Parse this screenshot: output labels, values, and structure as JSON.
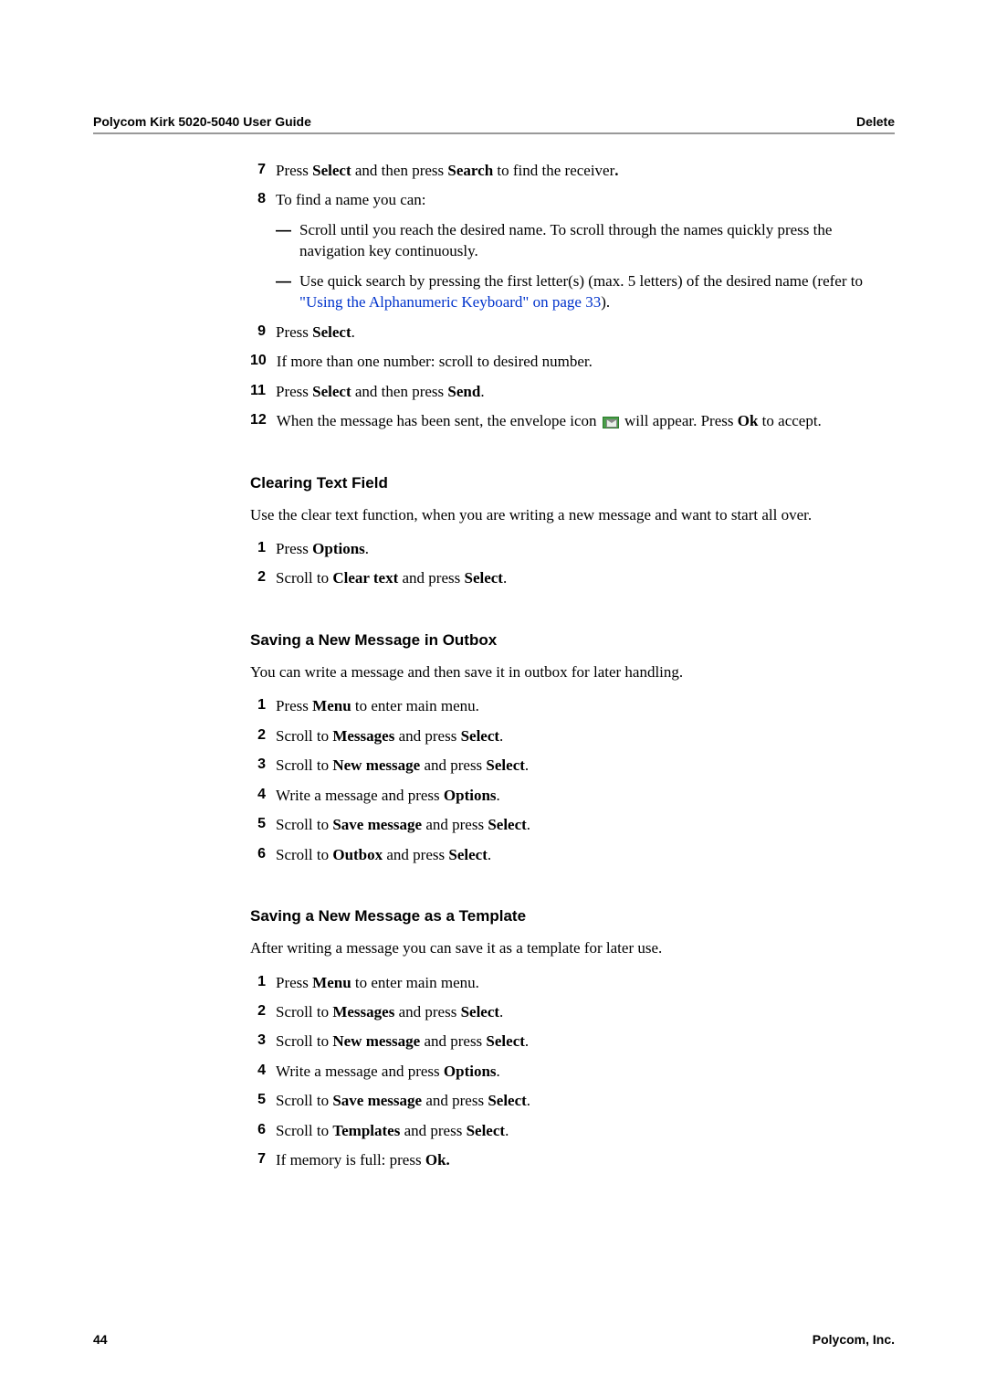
{
  "header": {
    "left": "Polycom Kirk 5020-5040 User Guide",
    "right": "Delete"
  },
  "continued_steps": [
    {
      "num": "7",
      "segments": [
        {
          "t": "Press "
        },
        {
          "t": "Select",
          "b": true
        },
        {
          "t": " and then press "
        },
        {
          "t": "Search",
          "b": true
        },
        {
          "t": " to find the receiver"
        },
        {
          "t": ".",
          "b": true
        }
      ]
    },
    {
      "num": "8",
      "segments": [
        {
          "t": "To find a name you can:"
        }
      ],
      "sub": [
        {
          "segments": [
            {
              "t": "Scroll until you reach the desired name. To scroll through the names quickly press the navigation key continuously."
            }
          ]
        },
        {
          "segments": [
            {
              "t": "Use quick search by pressing the first letter(s) (max. 5 letters) of the desired name (refer to "
            },
            {
              "t": "\"Using the Alphanumeric Keyboard\" on page 33",
              "link": true
            },
            {
              "t": ")."
            }
          ]
        }
      ]
    },
    {
      "num": "9",
      "segments": [
        {
          "t": "Press "
        },
        {
          "t": "Select",
          "b": true
        },
        {
          "t": "."
        }
      ]
    },
    {
      "num": "10",
      "segments": [
        {
          "t": "If more than one number: scroll to desired number."
        }
      ]
    },
    {
      "num": "11",
      "segments": [
        {
          "t": "Press "
        },
        {
          "t": "Select",
          "b": true
        },
        {
          "t": " and then press "
        },
        {
          "t": "Send",
          "b": true
        },
        {
          "t": "."
        }
      ]
    },
    {
      "num": "12",
      "segments": [
        {
          "t": "When the message has been sent, the envelope icon "
        },
        {
          "t": "",
          "icon": "envelope"
        },
        {
          "t": " will appear. Press "
        },
        {
          "t": "Ok",
          "b": true
        },
        {
          "t": " to accept."
        }
      ]
    }
  ],
  "sections": [
    {
      "heading": "Clearing Text Field",
      "intro": "Use the clear text function, when you are writing a new message and want to start all over.",
      "steps": [
        {
          "num": "1",
          "segments": [
            {
              "t": "Press "
            },
            {
              "t": "Options",
              "b": true
            },
            {
              "t": "."
            }
          ]
        },
        {
          "num": "2",
          "segments": [
            {
              "t": "Scroll to "
            },
            {
              "t": "Clear text",
              "b": true
            },
            {
              "t": " and press "
            },
            {
              "t": "Select",
              "b": true
            },
            {
              "t": "."
            }
          ]
        }
      ]
    },
    {
      "heading": "Saving a New Message in Outbox",
      "intro": "You can write a message and then save it in outbox for later handling.",
      "steps": [
        {
          "num": "1",
          "segments": [
            {
              "t": "Press "
            },
            {
              "t": "Menu",
              "b": true
            },
            {
              "t": " to enter main menu."
            }
          ]
        },
        {
          "num": "2",
          "segments": [
            {
              "t": "Scroll to "
            },
            {
              "t": "Messages",
              "b": true
            },
            {
              "t": " and press "
            },
            {
              "t": "Select",
              "b": true
            },
            {
              "t": "."
            }
          ]
        },
        {
          "num": "3",
          "segments": [
            {
              "t": "Scroll to "
            },
            {
              "t": "New message",
              "b": true
            },
            {
              "t": " and press "
            },
            {
              "t": "Select",
              "b": true
            },
            {
              "t": "."
            }
          ]
        },
        {
          "num": "4",
          "segments": [
            {
              "t": "Write a message and press "
            },
            {
              "t": "Options",
              "b": true
            },
            {
              "t": "."
            }
          ]
        },
        {
          "num": "5",
          "segments": [
            {
              "t": "Scroll to "
            },
            {
              "t": "Save message",
              "b": true
            },
            {
              "t": " and press "
            },
            {
              "t": "Select",
              "b": true
            },
            {
              "t": "."
            }
          ]
        },
        {
          "num": "6",
          "segments": [
            {
              "t": "Scroll to "
            },
            {
              "t": "Outbox",
              "b": true
            },
            {
              "t": " and press "
            },
            {
              "t": "Select",
              "b": true
            },
            {
              "t": "."
            }
          ]
        }
      ]
    },
    {
      "heading": "Saving a New Message as a Template",
      "intro": "After writing a message you can save it as a template for later use.",
      "steps": [
        {
          "num": "1",
          "segments": [
            {
              "t": "Press "
            },
            {
              "t": "Menu",
              "b": true
            },
            {
              "t": " to enter main menu."
            }
          ]
        },
        {
          "num": "2",
          "segments": [
            {
              "t": "Scroll to "
            },
            {
              "t": "Messages",
              "b": true
            },
            {
              "t": " and press "
            },
            {
              "t": "Select",
              "b": true
            },
            {
              "t": "."
            }
          ]
        },
        {
          "num": "3",
          "segments": [
            {
              "t": "Scroll to "
            },
            {
              "t": "New message",
              "b": true
            },
            {
              "t": " and press "
            },
            {
              "t": "Select",
              "b": true
            },
            {
              "t": "."
            }
          ]
        },
        {
          "num": "4",
          "segments": [
            {
              "t": "Write a message and press "
            },
            {
              "t": "Options",
              "b": true
            },
            {
              "t": "."
            }
          ]
        },
        {
          "num": "5",
          "segments": [
            {
              "t": "Scroll to "
            },
            {
              "t": "Save message",
              "b": true
            },
            {
              "t": " and press "
            },
            {
              "t": "Select",
              "b": true
            },
            {
              "t": "."
            }
          ]
        },
        {
          "num": "6",
          "segments": [
            {
              "t": "Scroll to "
            },
            {
              "t": "Templates ",
              "b": true
            },
            {
              "t": " and press "
            },
            {
              "t": "Select",
              "b": true
            },
            {
              "t": "."
            }
          ]
        },
        {
          "num": "7",
          "segments": [
            {
              "t": "If memory is full: press "
            },
            {
              "t": "Ok.",
              "b": true
            }
          ]
        }
      ]
    }
  ],
  "footer": {
    "page_num": "44",
    "company": "Polycom, Inc."
  }
}
